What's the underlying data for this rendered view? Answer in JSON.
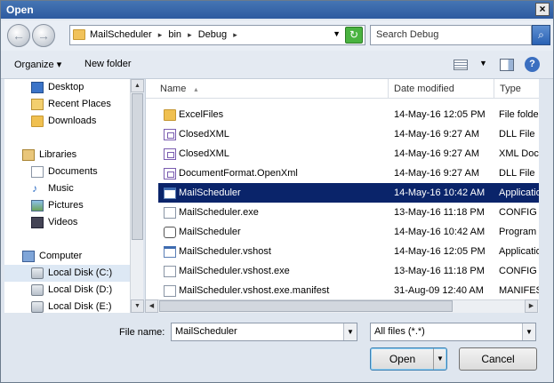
{
  "window": {
    "title": "Open",
    "close_glyph": "×"
  },
  "nav": {
    "back_glyph": "←",
    "forward_glyph": "→",
    "breadcrumbs": [
      "MailScheduler",
      "bin",
      "Debug"
    ],
    "separator": "▸",
    "search_placeholder": "Search Debug"
  },
  "toolbar": {
    "organize_label": "Organize ▾",
    "new_folder_label": "New folder",
    "help_glyph": "?"
  },
  "sidebar": {
    "items": [
      {
        "label": "Desktop",
        "icon": "desktop-icon"
      },
      {
        "label": "Recent Places",
        "icon": "recent-places-icon"
      },
      {
        "label": "Downloads",
        "icon": "downloads-icon"
      },
      {
        "label": "Libraries",
        "icon": "libraries-icon"
      },
      {
        "label": "Documents",
        "icon": "documents-icon"
      },
      {
        "label": "Music",
        "icon": "music-icon"
      },
      {
        "label": "Pictures",
        "icon": "pictures-icon"
      },
      {
        "label": "Videos",
        "icon": "videos-icon"
      },
      {
        "label": "Computer",
        "icon": "computer-icon"
      },
      {
        "label": "Local Disk (C:)",
        "icon": "drive-icon"
      },
      {
        "label": "Local Disk (D:)",
        "icon": "drive-icon"
      },
      {
        "label": "Local Disk (E:)",
        "icon": "drive-icon"
      }
    ]
  },
  "files": {
    "columns": [
      "Name",
      "Date modified",
      "Type"
    ],
    "sort_glyph": "▴",
    "rows": [
      {
        "name": "ExcelFiles",
        "date": "14-May-16 12:05 PM",
        "type": "File folder",
        "icon": "folder-icon"
      },
      {
        "name": "ClosedXML",
        "date": "14-May-16 9:27 AM",
        "type": "DLL File",
        "icon": "dll-icon"
      },
      {
        "name": "ClosedXML",
        "date": "14-May-16 9:27 AM",
        "type": "XML Document",
        "icon": "xml-icon"
      },
      {
        "name": "DocumentFormat.OpenXml",
        "date": "14-May-16 9:27 AM",
        "type": "DLL File",
        "icon": "dll-icon"
      },
      {
        "name": "MailScheduler",
        "date": "14-May-16 10:42 AM",
        "type": "Application",
        "icon": "application-icon",
        "selected": true
      },
      {
        "name": "MailScheduler.exe",
        "date": "13-May-16 11:18 PM",
        "type": "CONFIG File",
        "icon": "config-icon"
      },
      {
        "name": "MailScheduler",
        "date": "14-May-16 10:42 AM",
        "type": "Program Debug Database",
        "icon": "pdb-icon"
      },
      {
        "name": "MailScheduler.vshost",
        "date": "14-May-16 12:05 PM",
        "type": "Application",
        "icon": "application-icon"
      },
      {
        "name": "MailScheduler.vshost.exe",
        "date": "13-May-16 11:18 PM",
        "type": "CONFIG File",
        "icon": "config-icon"
      },
      {
        "name": "MailScheduler.vshost.exe.manifest",
        "date": "31-Aug-09 12:40 AM",
        "type": "MANIFEST File",
        "icon": "manifest-icon"
      }
    ]
  },
  "footer": {
    "file_name_label": "File name:",
    "file_name_value": "MailScheduler",
    "filter_value": "All files (*.*)",
    "open_label": "Open",
    "cancel_label": "Cancel"
  }
}
